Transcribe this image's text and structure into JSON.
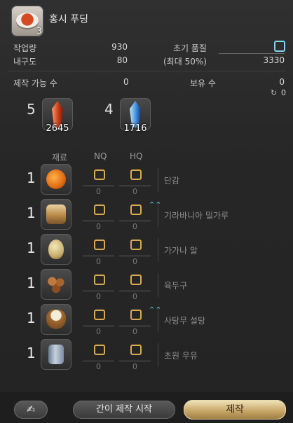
{
  "item": {
    "name": "홍시 푸딩",
    "yield_badge": "3"
  },
  "stats": {
    "progress_label": "작업량",
    "progress_value": "930",
    "durability_label": "내구도",
    "durability_value": "80",
    "initial_quality_label": "초기 품질",
    "max_hq_text": "(최대 50%)",
    "max_quality_value": "3330"
  },
  "counts": {
    "craftable_label": "제작 가능 수",
    "craftable_value": "0",
    "owned_label": "보유 수",
    "owned_value": "0",
    "owned_sub_value": "0"
  },
  "crystals": [
    {
      "need": "5",
      "have": "2645",
      "kind": "fire-crystal"
    },
    {
      "need": "4",
      "have": "1716",
      "kind": "ice-crystal"
    }
  ],
  "table": {
    "col_material": "재료",
    "col_nq": "NQ",
    "col_hq": "HQ"
  },
  "materials": [
    {
      "need": "1",
      "name": "단감",
      "nq": "0",
      "hq": "0",
      "hq_marker": false,
      "color": "#e06a12"
    },
    {
      "need": "1",
      "name": "기라바니아 밀가루",
      "nq": "0",
      "hq": "0",
      "hq_marker": true,
      "hq_marker_glyph": "⌃⌃",
      "color": "#c89a5a"
    },
    {
      "need": "1",
      "name": "가가나 알",
      "nq": "0",
      "hq": "0",
      "hq_marker": false,
      "color": "#d8c88a"
    },
    {
      "need": "1",
      "name": "육두구",
      "nq": "0",
      "hq": "0",
      "hq_marker": false,
      "color": "#9a5a2a"
    },
    {
      "need": "1",
      "name": "사탕무 설탕",
      "nq": "0",
      "hq": "0",
      "hq_marker": true,
      "hq_marker_glyph": "⌃⌃",
      "color": "#b07a3a"
    },
    {
      "need": "1",
      "name": "초원 우유",
      "nq": "0",
      "hq": "0",
      "hq_marker": false,
      "color": "#8a9ab0"
    }
  ],
  "buttons": {
    "quick_synthesis": "간이 제작 시작",
    "synthesize": "제작"
  },
  "colors": {
    "accent_gold": "#d9aa52",
    "accent_blue": "#7fd4f0"
  }
}
